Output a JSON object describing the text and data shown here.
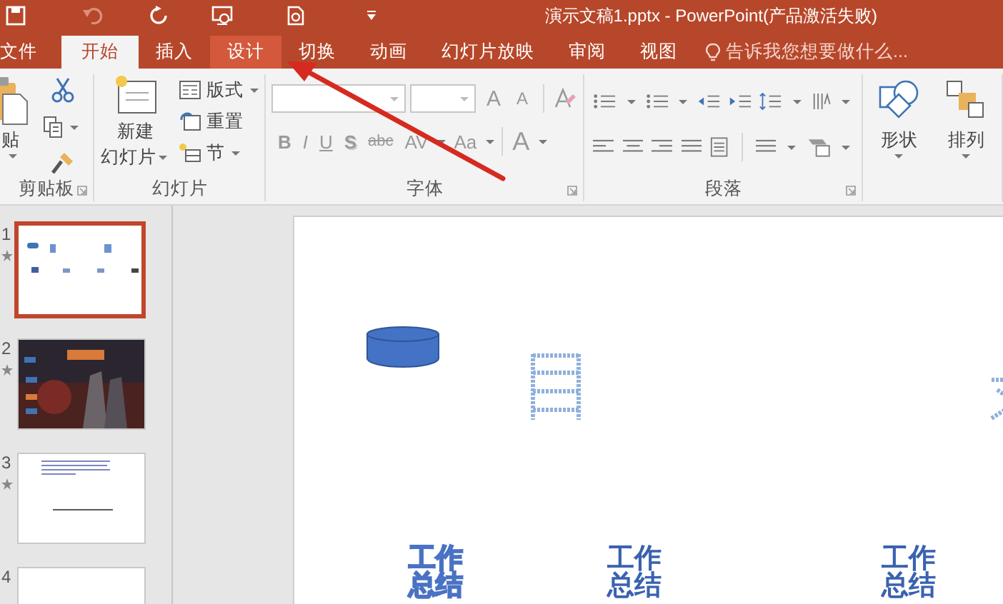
{
  "window": {
    "title": "演示文稿1.pptx - PowerPoint(产品激活失败)"
  },
  "tabs": [
    {
      "label": "文件",
      "selected": false,
      "hovered": false
    },
    {
      "label": "开始",
      "selected": true,
      "hovered": false
    },
    {
      "label": "插入",
      "selected": false,
      "hovered": false
    },
    {
      "label": "设计",
      "selected": false,
      "hovered": true
    },
    {
      "label": "切换",
      "selected": false,
      "hovered": false
    },
    {
      "label": "动画",
      "selected": false,
      "hovered": false
    },
    {
      "label": "幻灯片放映",
      "selected": false,
      "hovered": false
    },
    {
      "label": "审阅",
      "selected": false,
      "hovered": false
    },
    {
      "label": "视图",
      "selected": false,
      "hovered": false
    }
  ],
  "tell_me": {
    "placeholder": "告诉我您想要做什么..."
  },
  "ribbon": {
    "clipboard": {
      "label": "剪贴板",
      "paste": "贴"
    },
    "slides": {
      "label": "幻灯片",
      "new_slide": [
        "新建",
        "幻灯片"
      ],
      "layout": "版式",
      "reset": "重置",
      "section": "节"
    },
    "font": {
      "label": "字体",
      "buttons": [
        "B",
        "I",
        "U",
        "S",
        "abc",
        "AV",
        "Aa"
      ],
      "color_button": "A",
      "grow": "A",
      "shrink": "A"
    },
    "paragraph": {
      "label": "段落"
    },
    "drawing": {
      "shapes": "形状",
      "arrange": "排列"
    }
  },
  "slides_pane": [
    {
      "number": "1",
      "selected": true,
      "kind": "contents"
    },
    {
      "number": "2",
      "selected": false
    },
    {
      "number": "3",
      "selected": false,
      "kind": "text"
    },
    {
      "number": "4",
      "selected": false,
      "kind": "blank"
    }
  ],
  "slide": {
    "texts": [
      {
        "text": "工作总结",
        "kind": "outline"
      },
      {
        "text": "工作总结",
        "kind": "solid"
      },
      {
        "text": "工作总结",
        "kind": "solid"
      }
    ]
  }
}
